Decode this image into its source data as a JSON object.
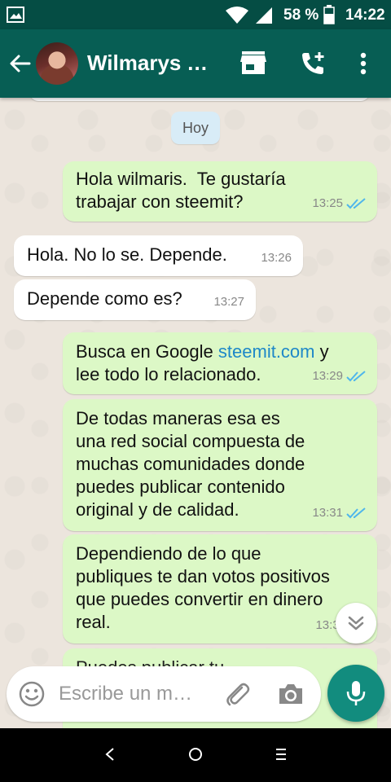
{
  "status_bar": {
    "battery_percent": "58 %",
    "time": "14:22"
  },
  "header": {
    "contact_name": "Wilmarys Y…"
  },
  "chat": {
    "day_label": "Hoy",
    "messages": [
      {
        "direction": "out",
        "text": "Hola wilmaris.  Te gustaría\ntrabajar con steemit?",
        "time": "13:25",
        "read": true
      },
      {
        "direction": "in",
        "text": "Hola. No lo se. Depende.",
        "time": "13:26"
      },
      {
        "direction": "in",
        "text": "Depende como es?",
        "time": "13:27"
      },
      {
        "direction": "out",
        "text_before": "Busca en Google ",
        "link": "steemit.com",
        "text_after": " y\nlee todo lo relacionado.",
        "time": "13:29",
        "read": true
      },
      {
        "direction": "out",
        "text": "De todas maneras esa es\nuna red social compuesta de\nmuchas comunidades donde\npuedes publicar contenido\noriginal y de calidad.",
        "time": "13:31",
        "read": true
      },
      {
        "direction": "out",
        "text": "Dependiendo de lo que\npubliques te dan votos positivos\nque puedes convertir en dinero\nreal.",
        "time": "13:32"
      },
      {
        "direction": "out",
        "text": "Puedes publicar tu...",
        "time": ""
      }
    ]
  },
  "composer": {
    "placeholder": "Escribe un m…"
  },
  "colors": {
    "header": "#075e54",
    "status_bar": "#054d44",
    "outgoing_bubble": "#dcf8c6",
    "incoming_bubble": "#ffffff",
    "read_ticks": "#4fb6ec",
    "accent": "#128c7e"
  },
  "icons": {
    "status_left": "image-notification-icon",
    "wifi": "wifi-icon",
    "signal": "cell-signal-icon",
    "battery": "battery-icon",
    "back": "arrow-back-icon",
    "store": "store-icon",
    "add_call": "add-call-icon",
    "menu": "more-vert-icon",
    "emoji": "emoji-icon",
    "attach": "paperclip-icon",
    "camera": "camera-icon",
    "mic": "mic-icon",
    "scroll_down": "double-chevron-down-icon"
  }
}
